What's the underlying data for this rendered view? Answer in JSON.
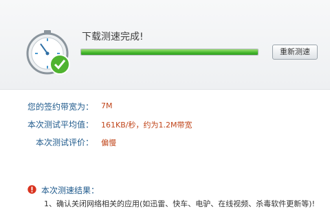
{
  "status": {
    "message": "下载测速完成!",
    "progress": 1.0
  },
  "toolbar": {
    "retest_label": "重新测速"
  },
  "info": {
    "contract_bandwidth": {
      "label": "您的签约带宽为：",
      "value": "7M"
    },
    "average": {
      "label": "本次测试平均值：",
      "value": "161KB/秒，约为1.2M带宽"
    },
    "rating": {
      "label": "本次测试评价：",
      "value": "偏慢"
    }
  },
  "result": {
    "title": "本次测速结果：",
    "item1": "1、确认关闭网络相关的应用(如迅雷、快车、电驴、在线视频、杀毒软件更新等)!"
  },
  "colors": {
    "accent": "#1f5a8c",
    "value": "#c0451a",
    "progress": "#46b82e"
  },
  "icons": {
    "gauge": "speedometer-check-icon",
    "warning": "warning-icon"
  }
}
